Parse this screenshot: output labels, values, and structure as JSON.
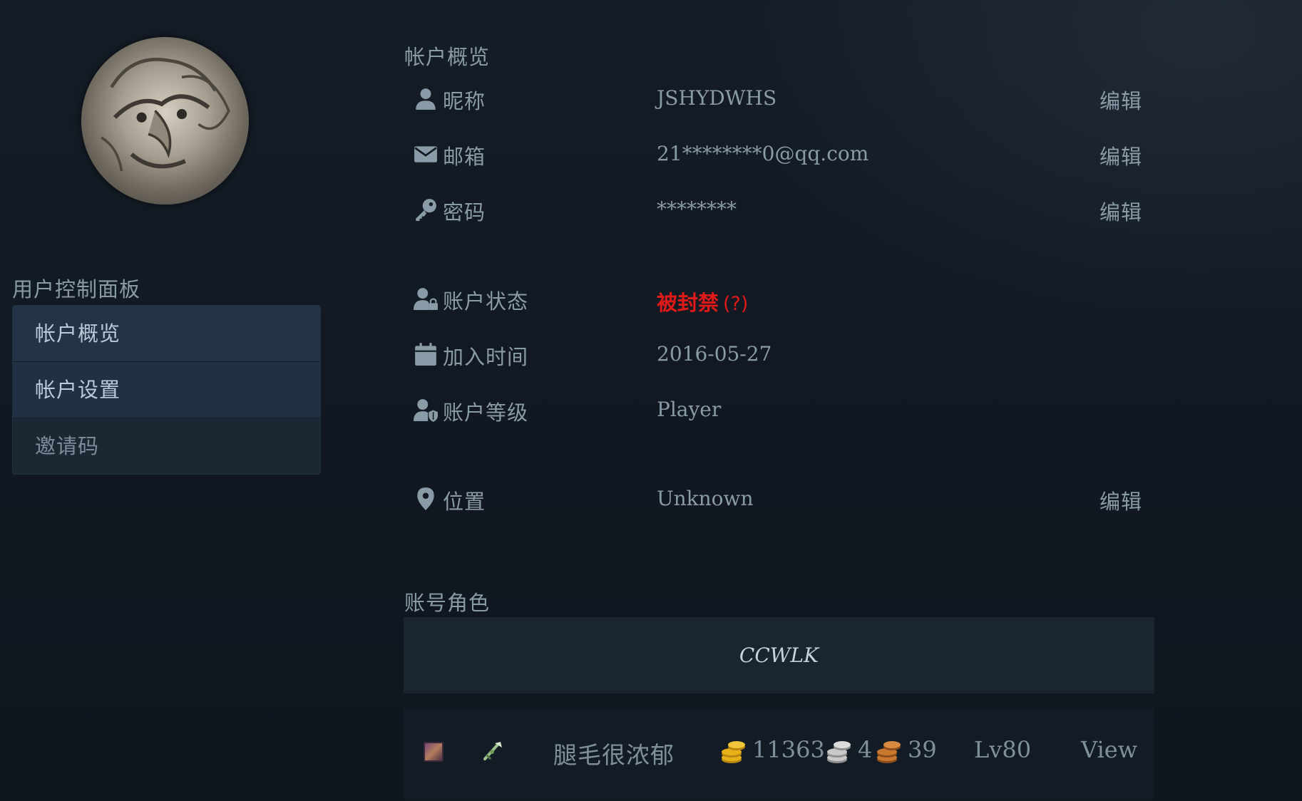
{
  "sidebar": {
    "title": "用户控制面板",
    "items": [
      {
        "label": "帐户概览"
      },
      {
        "label": "帐户设置"
      },
      {
        "label": "邀请码"
      }
    ]
  },
  "overview": {
    "title": "帐户概览",
    "edit_label": "编辑",
    "nickname": {
      "icon": "user-icon",
      "label": "昵称",
      "value": "JSHYDWHS"
    },
    "email": {
      "icon": "envelope-icon",
      "label": "邮箱",
      "value": "21********0@qq.com"
    },
    "password": {
      "icon": "key-icon",
      "label": "密码",
      "value": "********"
    },
    "status": {
      "icon": "user-lock-icon",
      "label": "账户状态",
      "value": "被封禁",
      "hint": "(?)",
      "color": "#e01919"
    },
    "joined": {
      "icon": "calendar-icon",
      "label": "加入时间",
      "value": "2016-05-27"
    },
    "level": {
      "icon": "user-shield-icon",
      "label": "账户等级",
      "value": "Player"
    },
    "location": {
      "icon": "map-pin-icon",
      "label": "位置",
      "value": "Unknown"
    }
  },
  "characters": {
    "title": "账号角色",
    "realm": "CCWLK",
    "list": [
      {
        "race_icon": "race-portrait-icon",
        "class_icon": "class-crest-icon",
        "name": "腿毛很浓郁",
        "gold": "11363",
        "silver": "4",
        "copper": "39",
        "level": "Lv80",
        "action": "View"
      }
    ]
  },
  "colors": {
    "background": "#121a23",
    "text": "#8a9ba8",
    "banned": "#e01919",
    "gold": "#e8b11a",
    "silver": "#c9c9c9",
    "copper": "#c8782f"
  }
}
